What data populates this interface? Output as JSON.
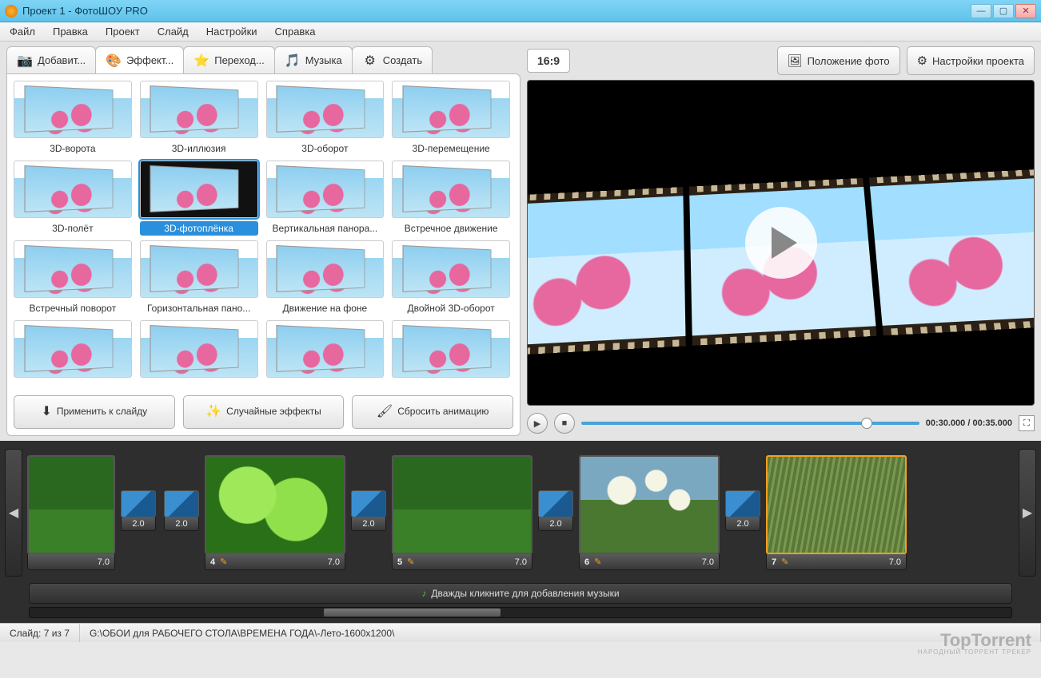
{
  "window": {
    "title": "Проект 1 - ФотоШОУ PRO"
  },
  "menu": [
    "Файл",
    "Правка",
    "Проект",
    "Слайд",
    "Настройки",
    "Справка"
  ],
  "tabs": [
    {
      "icon": "📷",
      "label": "Добавит..."
    },
    {
      "icon": "🎨",
      "label": "Эффект..."
    },
    {
      "icon": "⭐",
      "label": "Переход..."
    },
    {
      "icon": "🎵",
      "label": "Музыка"
    },
    {
      "icon": "⚙",
      "label": "Создать"
    }
  ],
  "effects": [
    {
      "label": "3D-ворота"
    },
    {
      "label": "3D-иллюзия"
    },
    {
      "label": "3D-оборот"
    },
    {
      "label": "3D-перемещение"
    },
    {
      "label": "3D-полёт"
    },
    {
      "label": "3D-фотоплёнка",
      "selected": true,
      "dark": true
    },
    {
      "label": "Вертикальная панора..."
    },
    {
      "label": "Встречное движение"
    },
    {
      "label": "Встречный поворот"
    },
    {
      "label": "Горизонтальная пано..."
    },
    {
      "label": "Движение на фоне"
    },
    {
      "label": "Двойной 3D-оборот"
    },
    {
      "label": ""
    },
    {
      "label": ""
    },
    {
      "label": ""
    },
    {
      "label": ""
    }
  ],
  "panel_buttons": {
    "apply": "Применить к слайду",
    "random": "Случайные эффекты",
    "reset": "Сбросить анимацию"
  },
  "preview": {
    "ratio": "16:9",
    "position_btn": "Положение фото",
    "settings_btn": "Настройки проекта",
    "time_current": "00:30.000",
    "time_total": "00:35.000"
  },
  "timeline": {
    "slides": [
      {
        "num": "",
        "dur": "7.0",
        "cls": "field narrow"
      },
      {
        "num": "4",
        "dur": "7.0",
        "cls": "leaves"
      },
      {
        "num": "5",
        "dur": "7.0",
        "cls": "field"
      },
      {
        "num": "6",
        "dur": "7.0",
        "cls": "dandelion"
      },
      {
        "num": "7",
        "dur": "7.0",
        "cls": "grass",
        "sel": true
      }
    ],
    "transitions": [
      {
        "dur": "2.0"
      },
      {
        "dur": "2.0"
      },
      {
        "dur": "2.0"
      },
      {
        "dur": "2.0"
      },
      {
        "dur": "2.0"
      }
    ],
    "music_hint": "Дважды кликните для добавления музыки"
  },
  "status": {
    "slide_count": "Слайд: 7 из 7",
    "path": "G:\\ОБОИ для РАБОЧЕГО СТОЛА\\ВРЕМЕНА ГОДА\\-Лето-1600x1200\\"
  },
  "watermark": {
    "name": "TopTorrent",
    "sub": "НАРОДНЫЙ ТОРРЕНТ ТРЕКЕР"
  }
}
